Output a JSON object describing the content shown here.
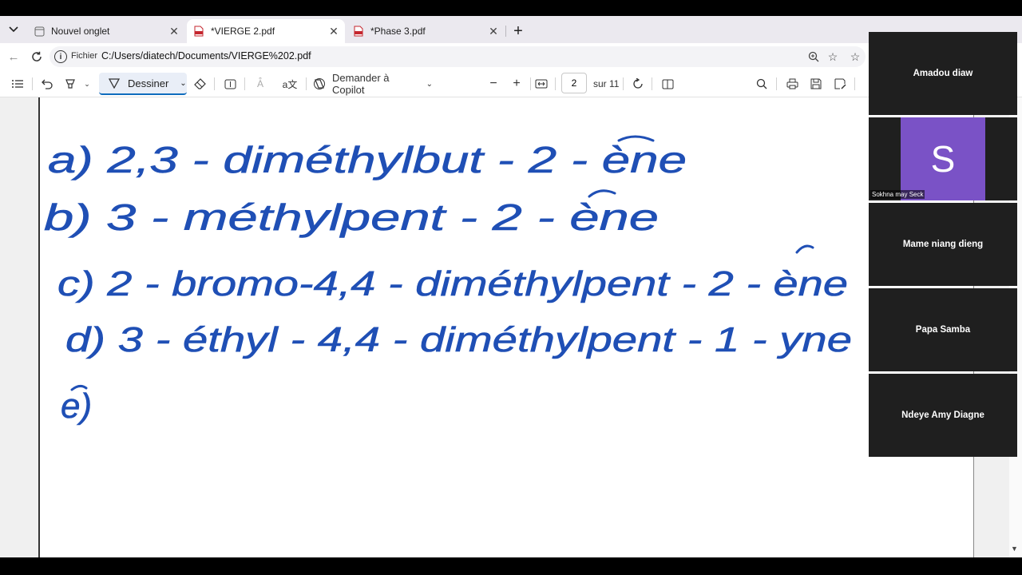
{
  "browser": {
    "tabs": [
      {
        "title": "Nouvel onglet",
        "active": false
      },
      {
        "title": "*VIERGE 2.pdf",
        "active": true
      },
      {
        "title": "*Phase 3.pdf",
        "active": false
      }
    ],
    "address": {
      "scheme": "Fichier",
      "url": "C:/Users/diatech/Documents/VIERGE%202.pdf"
    }
  },
  "pdf_toolbar": {
    "draw_label": "Dessiner",
    "copilot_label": "Demander à Copilot",
    "page_current": "2",
    "page_total": "sur 11"
  },
  "handwriting": {
    "ink_color": "#1f4fb5",
    "lines": [
      "a) 2,3 - diméthylbut - 2 - ène",
      "b) 3 - méthylpent - 2 - ène",
      "c) 2 - bromo-4,4 - diméthylpent - 2 - ène",
      "d) 3 - éthyl - 4,4 - diméthylpent - 1 - yne",
      "e)"
    ]
  },
  "participants": [
    {
      "name": "Amadou diaw"
    },
    {
      "name": "Sokhna may Seck",
      "initial": "S",
      "avatar_color": "#7a52c6"
    },
    {
      "name": "Mame niang dieng"
    },
    {
      "name": "Papa Samba"
    },
    {
      "name": "Ndeye Amy Diagne"
    }
  ]
}
